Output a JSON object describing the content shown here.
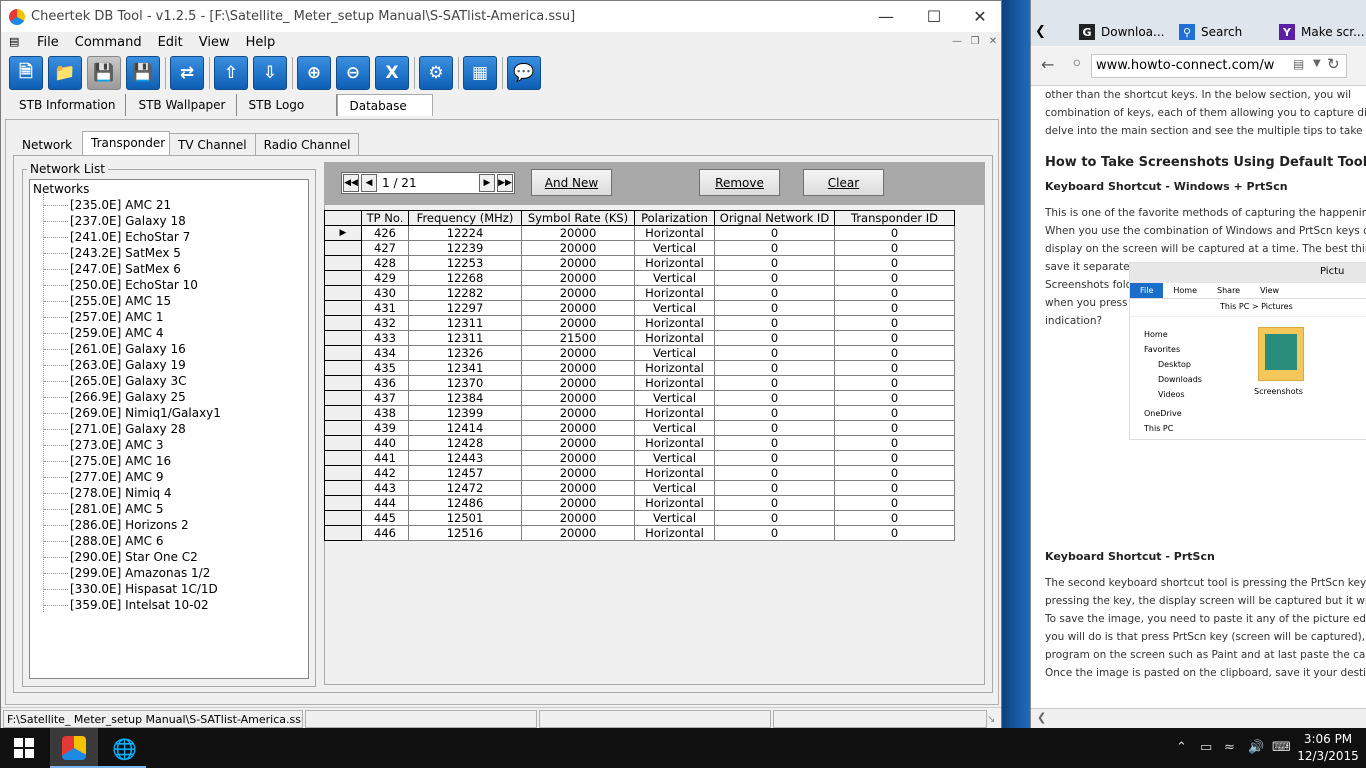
{
  "window": {
    "title": "Cheertek DB Tool - v1.2.5 - [F:\\Satellite_ Meter_setup Manual\\S-SATlist-America.ssu]"
  },
  "menu": [
    "File",
    "Command",
    "Edit",
    "View",
    "Help"
  ],
  "toolbar_icons": [
    "new-file-icon",
    "open-folder-icon",
    "save-disabled-icon",
    "save-icon",
    "transfer-icon",
    "move-up-icon",
    "move-down-icon",
    "zoom-in-icon",
    "zoom-out-icon",
    "excel-export-icon",
    "settings-icon",
    "device-icon",
    "help-chat-icon"
  ],
  "top_tabs": [
    "STB Information",
    "STB Wallpaper",
    "STB Logo",
    "Database"
  ],
  "sub_tabs": [
    "Network",
    "Transponder",
    "TV Channel",
    "Radio Channel"
  ],
  "network_list": {
    "label": "Network List",
    "root": "Networks",
    "items": [
      "[235.0E] AMC 21",
      "[237.0E] Galaxy 18",
      "[241.0E] EchoStar 7",
      "[243.2E] SatMex 5",
      "[247.0E] SatMex 6",
      "[250.0E] EchoStar 10",
      "[255.0E] AMC 15",
      "[257.0E] AMC 1",
      "[259.0E] AMC 4",
      "[261.0E] Galaxy 16",
      "[263.0E] Galaxy 19",
      "[265.0E] Galaxy 3C",
      "[266.9E] Galaxy 25",
      "[269.0E] Nimiq1/Galaxy1",
      "[271.0E] Galaxy 28",
      "[273.0E] AMC 3",
      "[275.0E] AMC 16",
      "[277.0E] AMC 9",
      "[278.0E] Nimiq 4",
      "[281.0E] AMC 5",
      "[286.0E] Horizons 2",
      "[288.0E] AMC 6",
      "[290.0E] Star One C2",
      "[299.0E] Amazonas 1/2",
      "[330.0E] Hispasat 1C/1D",
      "[359.0E] Intelsat 10-02"
    ]
  },
  "pager": {
    "text": "1 / 21"
  },
  "buttons": {
    "and_new": "And New",
    "remove": "Remove",
    "clear": "Clear"
  },
  "table": {
    "headers": [
      "TP No.",
      "Frequency (MHz)",
      "Symbol Rate (KS)",
      "Polarization",
      "Orignal Network ID",
      "Transponder ID"
    ],
    "rows": [
      [
        "426",
        "12224",
        "20000",
        "Horizontal",
        "0",
        "0"
      ],
      [
        "427",
        "12239",
        "20000",
        "Vertical",
        "0",
        "0"
      ],
      [
        "428",
        "12253",
        "20000",
        "Horizontal",
        "0",
        "0"
      ],
      [
        "429",
        "12268",
        "20000",
        "Vertical",
        "0",
        "0"
      ],
      [
        "430",
        "12282",
        "20000",
        "Horizontal",
        "0",
        "0"
      ],
      [
        "431",
        "12297",
        "20000",
        "Vertical",
        "0",
        "0"
      ],
      [
        "432",
        "12311",
        "20000",
        "Horizontal",
        "0",
        "0"
      ],
      [
        "433",
        "12311",
        "21500",
        "Horizontal",
        "0",
        "0"
      ],
      [
        "434",
        "12326",
        "20000",
        "Vertical",
        "0",
        "0"
      ],
      [
        "435",
        "12341",
        "20000",
        "Horizontal",
        "0",
        "0"
      ],
      [
        "436",
        "12370",
        "20000",
        "Horizontal",
        "0",
        "0"
      ],
      [
        "437",
        "12384",
        "20000",
        "Vertical",
        "0",
        "0"
      ],
      [
        "438",
        "12399",
        "20000",
        "Horizontal",
        "0",
        "0"
      ],
      [
        "439",
        "12414",
        "20000",
        "Vertical",
        "0",
        "0"
      ],
      [
        "440",
        "12428",
        "20000",
        "Horizontal",
        "0",
        "0"
      ],
      [
        "441",
        "12443",
        "20000",
        "Vertical",
        "0",
        "0"
      ],
      [
        "442",
        "12457",
        "20000",
        "Horizontal",
        "0",
        "0"
      ],
      [
        "443",
        "12472",
        "20000",
        "Vertical",
        "0",
        "0"
      ],
      [
        "444",
        "12486",
        "20000",
        "Horizontal",
        "0",
        "0"
      ],
      [
        "445",
        "12501",
        "20000",
        "Vertical",
        "0",
        "0"
      ],
      [
        "446",
        "12516",
        "20000",
        "Horizontal",
        "0",
        "0"
      ]
    ]
  },
  "statusbar": {
    "path": "F:\\Satellite_ Meter_setup Manual\\S-SATlist-America.ssu Open"
  },
  "browser": {
    "tabs": [
      "Downloa...",
      "Search",
      "Make scr..."
    ],
    "url": "www.howto-connect.com/w",
    "article": {
      "intro": [
        "other than the shortcut keys. In the below section, you wil",
        "combination of keys, each of them allowing you to capture differe",
        "delve into the main section and see the multiple tips to take screen"
      ],
      "heading": "How to Take Screenshots Using Default Tools in Windo",
      "sub1": "Keyboard Shortcut - Windows + PrtScn",
      "p1": [
        "This is one of the favorite methods of capturing the happening",
        "When you use the combination of Windows and PrtScn keys on y",
        "display on the screen will be captured at a time. The best thing i",
        "save it separately. Windows will automatically save the ca",
        "Screenshots folder of Pictures. You will see that the entire screen",
        "when you press both the keys. It means that you have taken a scre",
        "indication?"
      ],
      "sub2": "Keyboard Shortcut - PrtScn",
      "p2": [
        "The second keyboard shortcut tool is pressing the PrtScn key",
        "pressing the key, the display screen will be captured but it will not",
        "To save the image, you need to paste it any of the picture editing p",
        "you will do is that press PrtScn key (screen will be captured),",
        "program on the screen such as Paint and at last paste the capt",
        "Once the image is pasted on the clipboard, save it your destined fo"
      ]
    },
    "screenshot": {
      "title": "Pictu",
      "ribbon": [
        "File",
        "Home",
        "Share",
        "View"
      ],
      "crumb": "This PC  >  Pictures",
      "nav": [
        "Home",
        "Favorites",
        "Desktop",
        "Downloads",
        "Videos",
        "OneDrive",
        "This PC"
      ],
      "folder": "Screenshots"
    }
  },
  "taskbar": {
    "time": "3:06 PM",
    "date": "12/3/2015"
  }
}
